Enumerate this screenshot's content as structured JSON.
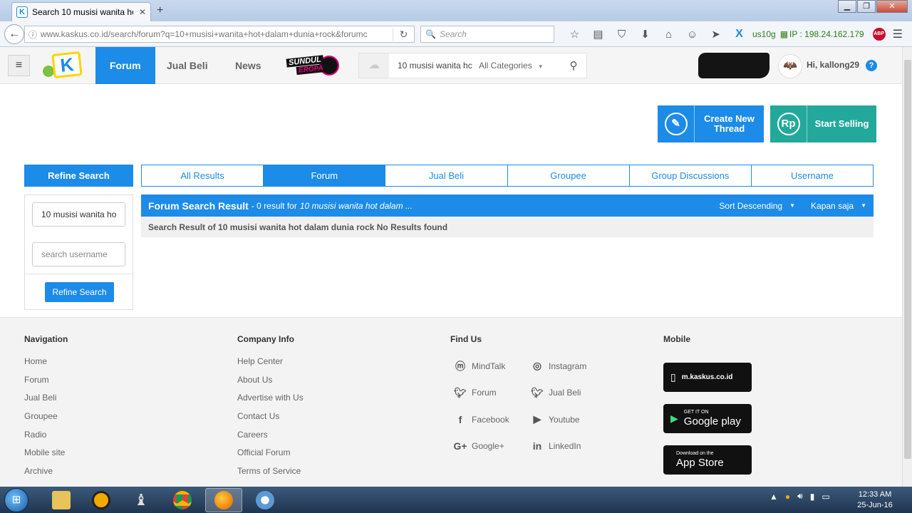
{
  "browser": {
    "tab_title": "Search 10 musisi wanita ho...",
    "tab_close": "✕",
    "new_tab": "+",
    "url": "www.kaskus.co.id/search/forum?q=10+musisi+wanita+hot+dalam+dunia+rock&forumc",
    "search_placeholder": "Search",
    "ext_user": "us10g",
    "ext_ip": "IP : 198.24.162.179",
    "abp_label": "ABP"
  },
  "header": {
    "nav": [
      "Forum",
      "Jual Beli",
      "News"
    ],
    "sundul_line1": "SUNDUL",
    "sundul_line2": "EROPA",
    "search_value": "10 musisi wanita hc",
    "category": "All Categories",
    "greeting": "Hi, kallong29",
    "help": "?"
  },
  "actions": {
    "create_thread": "Create New Thread",
    "start_selling": "Start Selling",
    "rp": "Rp"
  },
  "refine": {
    "heading": "Refine Search",
    "query_value": "10 musisi wanita ho",
    "username_placeholder": "search username",
    "button": "Refine Search"
  },
  "result_tabs": [
    "All Results",
    "Forum",
    "Jual Beli",
    "Groupee",
    "Group Discussions",
    "Username"
  ],
  "results": {
    "title": "Forum Search Result",
    "count": "- 0 result for",
    "query": "10 musisi wanita hot dalam ...",
    "sort": "Sort Descending",
    "time": "Kapan saja",
    "message": "Search Result of 10 musisi wanita hot dalam dunia rock No Results found"
  },
  "footer": {
    "navigation_heading": "Navigation",
    "navigation": [
      "Home",
      "Forum",
      "Jual Beli",
      "Groupee",
      "Radio",
      "Mobile site",
      "Archive"
    ],
    "company_heading": "Company Info",
    "company": [
      "Help Center",
      "About Us",
      "Advertise with Us",
      "Contact Us",
      "Careers",
      "Official Forum",
      "Terms of Service"
    ],
    "findus_heading": "Find Us",
    "findus": [
      "MindTalk",
      "Instagram",
      "Forum",
      "Jual Beli",
      "Facebook",
      "Youtube",
      "Google+",
      "LinkedIn"
    ],
    "mobile_heading": "Mobile",
    "mobile_site": "m.kaskus.co.id",
    "gplay_small": "GET IT ON",
    "gplay_big": "Google play",
    "appstore_small": "Download on the",
    "appstore_big": "App Store"
  },
  "taskbar": {
    "time": "12:33 AM",
    "date": "25-Jun-16"
  },
  "colors": {
    "primary": "#1d8be8",
    "teal": "#23a99b"
  }
}
